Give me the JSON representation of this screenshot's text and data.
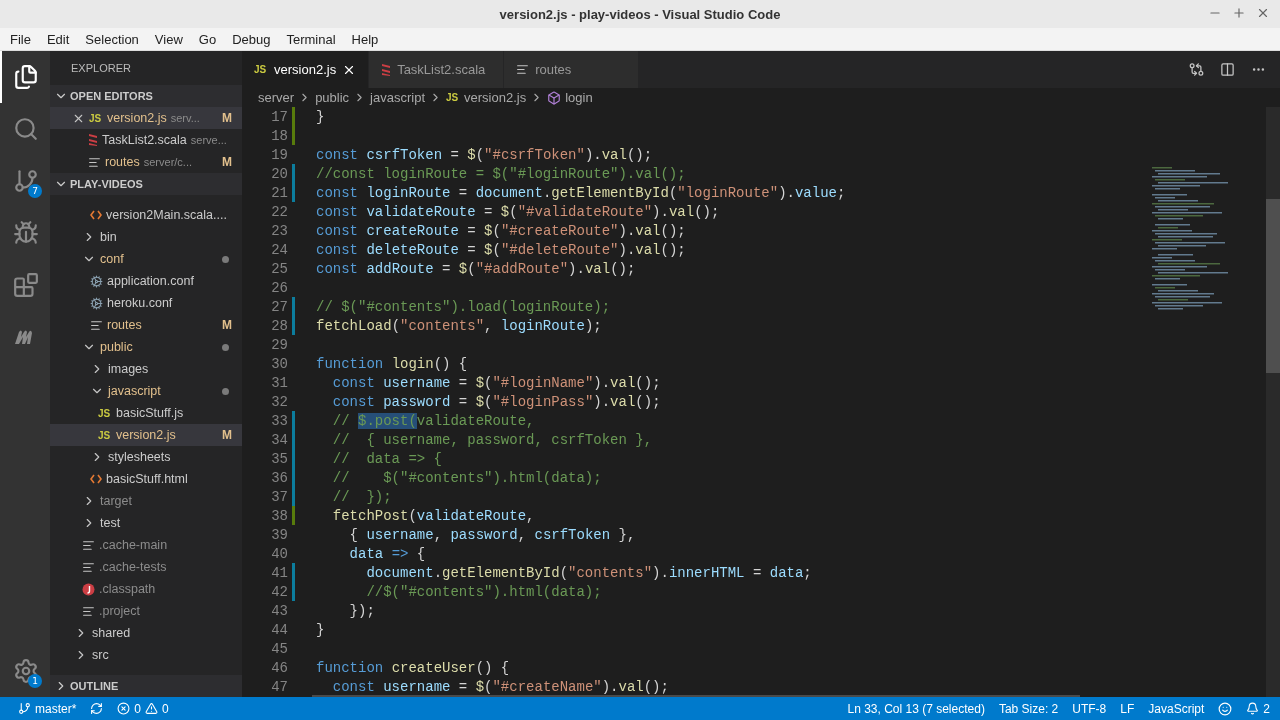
{
  "window": {
    "title": "version2.js - play-videos - Visual Studio Code"
  },
  "menu": [
    "File",
    "Edit",
    "Selection",
    "View",
    "Go",
    "Debug",
    "Terminal",
    "Help"
  ],
  "activity_bar": [
    {
      "kind": "files",
      "selected": true
    },
    {
      "kind": "search",
      "selected": false
    },
    {
      "kind": "source-control",
      "selected": false,
      "badge": "7"
    },
    {
      "kind": "debug",
      "selected": false
    },
    {
      "kind": "extensions",
      "selected": false
    },
    {
      "kind": "m-logo",
      "selected": false
    },
    {
      "kind": "settings",
      "selected": false,
      "badge": "1"
    }
  ],
  "sidebar": {
    "title": "EXPLORER",
    "open_editors": {
      "title": "OPEN EDITORS",
      "expanded": true,
      "items": [
        {
          "name": "version2.js",
          "icon_label": "JS",
          "kind": "js",
          "description": "serv...",
          "modified": true,
          "decoration": "M",
          "selected": true
        },
        {
          "name": "TaskList2.scala",
          "kind": "scala",
          "description": "serve...",
          "modified": false,
          "selected": false
        },
        {
          "name": "routes",
          "kind": "text",
          "description": "server/c...",
          "modified": true,
          "decoration": "M",
          "selected": false
        }
      ]
    },
    "project": {
      "title": "PLAY-VIDEOS",
      "expanded": true,
      "tree": [
        {
          "children": [
            {
              "children": [
                {
                  "name": "version2Main.scala....",
                  "kind": "html",
                  "modified": false,
                  "ignored": false,
                  "has_changes": false,
                  "selected": false
                }
              ]
            },
            {
              "name": "bin",
              "kind": "folder",
              "expanded": false,
              "modified": false,
              "ignored": false,
              "has_changes": false,
              "selected": false
            },
            {
              "name": "conf",
              "kind": "folder",
              "expanded": true,
              "modified": true,
              "ignored": false,
              "has_changes": true,
              "selected": false,
              "children": [
                {
                  "name": "application.conf",
                  "kind": "gear",
                  "modified": false,
                  "ignored": false,
                  "has_changes": false,
                  "selected": false
                },
                {
                  "name": "heroku.conf",
                  "kind": "gear",
                  "modified": false,
                  "ignored": false,
                  "has_changes": false,
                  "selected": false
                },
                {
                  "name": "routes",
                  "kind": "text",
                  "modified": true,
                  "ignored": false,
                  "has_changes": false,
                  "decoration": "M",
                  "selected": false
                }
              ]
            },
            {
              "name": "public",
              "kind": "folder",
              "expanded": true,
              "modified": true,
              "ignored": false,
              "has_changes": true,
              "selected": false,
              "children": [
                {
                  "name": "images",
                  "kind": "folder",
                  "expanded": false,
                  "modified": false,
                  "ignored": false,
                  "has_changes": false,
                  "selected": false
                },
                {
                  "name": "javascript",
                  "kind": "folder",
                  "expanded": true,
                  "modified": true,
                  "ignored": false,
                  "has_changes": true,
                  "selected": false,
                  "children": [
                    {
                      "name": "basicStuff.js",
                      "icon_label": "JS",
                      "kind": "js",
                      "modified": false,
                      "ignored": false,
                      "has_changes": false,
                      "selected": false
                    },
                    {
                      "name": "version2.js",
                      "icon_label": "JS",
                      "kind": "js",
                      "modified": true,
                      "ignored": false,
                      "has_changes": false,
                      "decoration": "M",
                      "selected": true
                    }
                  ]
                },
                {
                  "name": "stylesheets",
                  "kind": "folder",
                  "expanded": false,
                  "modified": false,
                  "ignored": false,
                  "has_changes": false,
                  "selected": false
                },
                {
                  "name": "basicStuff.html",
                  "kind": "html",
                  "modified": false,
                  "ignored": false,
                  "has_changes": false,
                  "selected": false
                }
              ]
            },
            {
              "name": "target",
              "kind": "folder",
              "expanded": false,
              "modified": false,
              "ignored": true,
              "has_changes": false,
              "selected": false
            },
            {
              "name": "test",
              "kind": "folder",
              "expanded": false,
              "modified": false,
              "ignored": false,
              "has_changes": false,
              "selected": false
            },
            {
              "name": ".cache-main",
              "kind": "text",
              "modified": false,
              "ignored": true,
              "has_changes": false,
              "selected": false
            },
            {
              "name": ".cache-tests",
              "kind": "text",
              "modified": false,
              "ignored": true,
              "has_changes": false,
              "selected": false
            },
            {
              "name": ".classpath",
              "kind": "java",
              "modified": false,
              "ignored": true,
              "has_changes": false,
              "selected": false
            },
            {
              "name": ".project",
              "kind": "text",
              "modified": false,
              "ignored": true,
              "has_changes": false,
              "selected": false
            }
          ]
        },
        {
          "name": "shared",
          "kind": "folder",
          "expanded": false,
          "modified": false,
          "ignored": false,
          "has_changes": false,
          "selected": false
        },
        {
          "name": "src",
          "kind": "folder",
          "expanded": false,
          "modified": false,
          "ignored": false,
          "has_changes": false,
          "selected": false
        }
      ]
    },
    "outline": {
      "title": "OUTLINE",
      "expanded": false
    }
  },
  "tabs": [
    {
      "label": "version2.js",
      "icon_label": "JS",
      "kind": "js",
      "selected": true
    },
    {
      "label": "TaskList2.scala",
      "kind": "scala",
      "selected": false
    },
    {
      "label": "routes",
      "kind": "text",
      "selected": false
    }
  ],
  "breadcrumbs": [
    {
      "label": "server",
      "kind": "folder"
    },
    {
      "label": "public",
      "kind": "folder"
    },
    {
      "label": "javascript",
      "kind": "folder"
    },
    {
      "label": "version2.js",
      "kind": "js",
      "icon_label": "JS"
    },
    {
      "label": "login",
      "kind": "symbol"
    }
  ],
  "editor_lines": [
    {
      "number": "17",
      "added": true,
      "modified": false,
      "tokens": [
        {
          "kind": "p",
          "text": "}"
        }
      ]
    },
    {
      "number": "18",
      "added": true,
      "modified": false
    },
    {
      "number": "19",
      "added": false,
      "modified": false,
      "tokens": [
        {
          "kind": "kw",
          "text": "const "
        },
        {
          "kind": "var",
          "text": "csrfToken"
        },
        {
          "kind": "p",
          "text": " = "
        },
        {
          "kind": "fn",
          "text": "$"
        },
        {
          "kind": "p",
          "text": "("
        },
        {
          "kind": "str",
          "text": "\"#csrfToken\""
        },
        {
          "kind": "p",
          "text": ")."
        },
        {
          "kind": "fn",
          "text": "val"
        },
        {
          "kind": "p",
          "text": "();"
        }
      ]
    },
    {
      "number": "20",
      "added": false,
      "modified": true,
      "tokens": [
        {
          "kind": "cmt",
          "text": "//const loginRoute = $(\"#loginRoute\").val();"
        }
      ]
    },
    {
      "number": "21",
      "added": false,
      "modified": true,
      "tokens": [
        {
          "kind": "kw",
          "text": "const "
        },
        {
          "kind": "var",
          "text": "loginRoute"
        },
        {
          "kind": "p",
          "text": " = "
        },
        {
          "kind": "var",
          "text": "document"
        },
        {
          "kind": "p",
          "text": "."
        },
        {
          "kind": "fn",
          "text": "getElementById"
        },
        {
          "kind": "p",
          "text": "("
        },
        {
          "kind": "str",
          "text": "\"loginRoute\""
        },
        {
          "kind": "p",
          "text": ")."
        },
        {
          "kind": "var",
          "text": "value"
        },
        {
          "kind": "p",
          "text": ";"
        }
      ]
    },
    {
      "number": "22",
      "added": false,
      "modified": false,
      "tokens": [
        {
          "kind": "kw",
          "text": "const "
        },
        {
          "kind": "var",
          "text": "validateRoute"
        },
        {
          "kind": "p",
          "text": " = "
        },
        {
          "kind": "fn",
          "text": "$"
        },
        {
          "kind": "p",
          "text": "("
        },
        {
          "kind": "str",
          "text": "\"#validateRoute\""
        },
        {
          "kind": "p",
          "text": ")."
        },
        {
          "kind": "fn",
          "text": "val"
        },
        {
          "kind": "p",
          "text": "();"
        }
      ]
    },
    {
      "number": "23",
      "added": false,
      "modified": false,
      "tokens": [
        {
          "kind": "kw",
          "text": "const "
        },
        {
          "kind": "var",
          "text": "createRoute"
        },
        {
          "kind": "p",
          "text": " = "
        },
        {
          "kind": "fn",
          "text": "$"
        },
        {
          "kind": "p",
          "text": "("
        },
        {
          "kind": "str",
          "text": "\"#createRoute\""
        },
        {
          "kind": "p",
          "text": ")."
        },
        {
          "kind": "fn",
          "text": "val"
        },
        {
          "kind": "p",
          "text": "();"
        }
      ]
    },
    {
      "number": "24",
      "added": false,
      "modified": false,
      "tokens": [
        {
          "kind": "kw",
          "text": "const "
        },
        {
          "kind": "var",
          "text": "deleteRoute"
        },
        {
          "kind": "p",
          "text": " = "
        },
        {
          "kind": "fn",
          "text": "$"
        },
        {
          "kind": "p",
          "text": "("
        },
        {
          "kind": "str",
          "text": "\"#deleteRoute\""
        },
        {
          "kind": "p",
          "text": ")."
        },
        {
          "kind": "fn",
          "text": "val"
        },
        {
          "kind": "p",
          "text": "();"
        }
      ]
    },
    {
      "number": "25",
      "added": false,
      "modified": false,
      "tokens": [
        {
          "kind": "kw",
          "text": "const "
        },
        {
          "kind": "var",
          "text": "addRoute"
        },
        {
          "kind": "p",
          "text": " = "
        },
        {
          "kind": "fn",
          "text": "$"
        },
        {
          "kind": "p",
          "text": "("
        },
        {
          "kind": "str",
          "text": "\"#addRoute\""
        },
        {
          "kind": "p",
          "text": ")."
        },
        {
          "kind": "fn",
          "text": "val"
        },
        {
          "kind": "p",
          "text": "();"
        }
      ]
    },
    {
      "number": "26",
      "added": false,
      "modified": false
    },
    {
      "number": "27",
      "added": false,
      "modified": true,
      "tokens": [
        {
          "kind": "cmt",
          "text": "// $(\"#contents\").load(loginRoute);"
        }
      ]
    },
    {
      "number": "28",
      "added": false,
      "modified": true,
      "tokens": [
        {
          "kind": "fn",
          "text": "fetchLoad"
        },
        {
          "kind": "p",
          "text": "("
        },
        {
          "kind": "str",
          "text": "\"contents\""
        },
        {
          "kind": "p",
          "text": ", "
        },
        {
          "kind": "var",
          "text": "loginRoute"
        },
        {
          "kind": "p",
          "text": ");"
        }
      ]
    },
    {
      "number": "29",
      "added": false,
      "modified": false
    },
    {
      "number": "30",
      "added": false,
      "modified": false,
      "tokens": [
        {
          "kind": "kw",
          "text": "function "
        },
        {
          "kind": "fn",
          "text": "login"
        },
        {
          "kind": "p",
          "text": "() {"
        }
      ]
    },
    {
      "number": "31",
      "added": false,
      "modified": false,
      "tokens": [
        {
          "kind": "kw",
          "text": "  const "
        },
        {
          "kind": "var",
          "text": "username"
        },
        {
          "kind": "p",
          "text": " = "
        },
        {
          "kind": "fn",
          "text": "$"
        },
        {
          "kind": "p",
          "text": "("
        },
        {
          "kind": "str",
          "text": "\"#loginName\""
        },
        {
          "kind": "p",
          "text": ")."
        },
        {
          "kind": "fn",
          "text": "val"
        },
        {
          "kind": "p",
          "text": "();"
        }
      ]
    },
    {
      "number": "32",
      "added": false,
      "modified": false,
      "tokens": [
        {
          "kind": "kw",
          "text": "  const "
        },
        {
          "kind": "var",
          "text": "password"
        },
        {
          "kind": "p",
          "text": " = "
        },
        {
          "kind": "fn",
          "text": "$"
        },
        {
          "kind": "p",
          "text": "("
        },
        {
          "kind": "str",
          "text": "\"#loginPass\""
        },
        {
          "kind": "p",
          "text": ")."
        },
        {
          "kind": "fn",
          "text": "val"
        },
        {
          "kind": "p",
          "text": "();"
        }
      ]
    },
    {
      "number": "33",
      "added": false,
      "modified": true,
      "tokens": [
        {
          "kind": "cmt",
          "text": "  // "
        },
        {
          "kind": "sel",
          "text": "$.post("
        },
        {
          "kind": "cmt",
          "text": "validateRoute,"
        }
      ]
    },
    {
      "number": "34",
      "added": false,
      "modified": true,
      "tokens": [
        {
          "kind": "cmt",
          "text": "  //  { username, password, csrfToken },"
        }
      ]
    },
    {
      "number": "35",
      "added": false,
      "modified": true,
      "tokens": [
        {
          "kind": "cmt",
          "text": "  //  data => {"
        }
      ]
    },
    {
      "number": "36",
      "added": false,
      "modified": true,
      "tokens": [
        {
          "kind": "cmt",
          "text": "  //    $(\"#contents\").html(data);"
        }
      ]
    },
    {
      "number": "37",
      "added": false,
      "modified": true,
      "tokens": [
        {
          "kind": "cmt",
          "text": "  //  });"
        }
      ]
    },
    {
      "number": "38",
      "added": true,
      "modified": false,
      "tokens": [
        {
          "kind": "fn",
          "text": "  fetchPost"
        },
        {
          "kind": "p",
          "text": "("
        },
        {
          "kind": "var",
          "text": "validateRoute"
        },
        {
          "kind": "p",
          "text": ","
        }
      ]
    },
    {
      "number": "39",
      "added": false,
      "modified": false,
      "tokens": [
        {
          "kind": "p",
          "text": "    { "
        },
        {
          "kind": "var",
          "text": "username"
        },
        {
          "kind": "p",
          "text": ", "
        },
        {
          "kind": "var",
          "text": "password"
        },
        {
          "kind": "p",
          "text": ", "
        },
        {
          "kind": "var",
          "text": "csrfToken"
        },
        {
          "kind": "p",
          "text": " },"
        }
      ]
    },
    {
      "number": "40",
      "added": false,
      "modified": false,
      "tokens": [
        {
          "kind": "var",
          "text": "    data "
        },
        {
          "kind": "kw",
          "text": "=>"
        },
        {
          "kind": "p",
          "text": " {"
        }
      ]
    },
    {
      "number": "41",
      "added": false,
      "modified": true,
      "tokens": [
        {
          "kind": "var",
          "text": "      document"
        },
        {
          "kind": "p",
          "text": "."
        },
        {
          "kind": "fn",
          "text": "getElementById"
        },
        {
          "kind": "p",
          "text": "("
        },
        {
          "kind": "str",
          "text": "\"contents\""
        },
        {
          "kind": "p",
          "text": ")."
        },
        {
          "kind": "var",
          "text": "innerHTML"
        },
        {
          "kind": "p",
          "text": " = "
        },
        {
          "kind": "var",
          "text": "data"
        },
        {
          "kind": "p",
          "text": ";"
        }
      ]
    },
    {
      "number": "42",
      "added": false,
      "modified": true,
      "tokens": [
        {
          "kind": "cmt",
          "text": "      //$(\"#contents\").html(data);"
        }
      ]
    },
    {
      "number": "43",
      "added": false,
      "modified": false,
      "tokens": [
        {
          "kind": "p",
          "text": "    });"
        }
      ]
    },
    {
      "number": "44",
      "added": false,
      "modified": false,
      "tokens": [
        {
          "kind": "p",
          "text": "}"
        }
      ]
    },
    {
      "number": "45",
      "added": false,
      "modified": false
    },
    {
      "number": "46",
      "added": false,
      "modified": false,
      "tokens": [
        {
          "kind": "kw",
          "text": "function "
        },
        {
          "kind": "fn",
          "text": "createUser"
        },
        {
          "kind": "p",
          "text": "() {"
        }
      ]
    },
    {
      "number": "47",
      "added": false,
      "modified": false,
      "tokens": [
        {
          "kind": "kw",
          "text": "  const "
        },
        {
          "kind": "var",
          "text": "username"
        },
        {
          "kind": "p",
          "text": " = "
        },
        {
          "kind": "fn",
          "text": "$"
        },
        {
          "kind": "p",
          "text": "("
        },
        {
          "kind": "str",
          "text": "\"#createName\""
        },
        {
          "kind": "p",
          "text": ")."
        },
        {
          "kind": "fn",
          "text": "val"
        },
        {
          "kind": "p",
          "text": "();"
        }
      ]
    }
  ],
  "status_bar": {
    "branch": "master*",
    "errors": "0",
    "warnings": "0",
    "position": "Ln 33, Col 13 (7 selected)",
    "tab_size": "Tab Size: 2",
    "encoding": "UTF-8",
    "eol": "LF",
    "language": "JavaScript",
    "notifications": "2"
  }
}
